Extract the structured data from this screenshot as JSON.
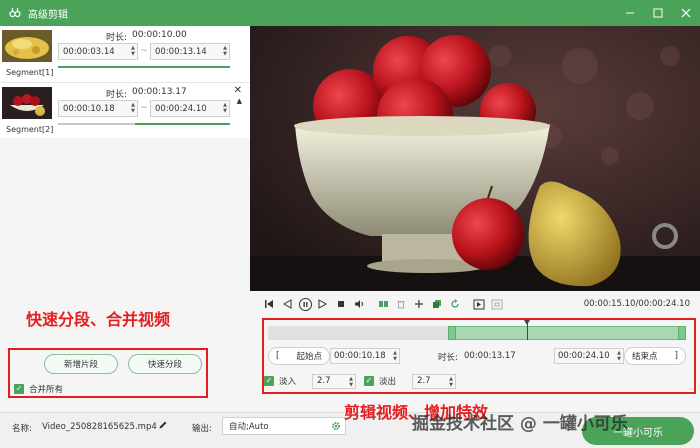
{
  "window": {
    "title": "高级剪辑"
  },
  "segments": [
    {
      "label": "Segment[1]",
      "duration_label": "时长:",
      "duration": "00:00:10.00",
      "start": "00:00:03.14",
      "end": "00:00:13.14",
      "bar_fill_start": 0.0,
      "bar_fill_end": 1.0
    },
    {
      "label": "Segment[2]",
      "duration_label": "时长:",
      "duration": "00:00:13.17",
      "start": "00:00:10.18",
      "end": "00:00:24.10",
      "bar_fill_start": 0.45,
      "bar_fill_end": 1.0
    }
  ],
  "annotations": {
    "left": "快速分段、合并视频",
    "right": "剪辑视频、增加特效",
    "watermark": "掘金技术社区 @ 一罐小可乐"
  },
  "left_actions": {
    "add_segment": "新增片段",
    "quick_split": "快速分段",
    "merge_all": "合并所有"
  },
  "player": {
    "time_readout": "00:00:15.10/00:00:24.10",
    "timeline_range_start": 0.43,
    "timeline_range_end": 1.0,
    "playhead": 0.62
  },
  "range": {
    "start_btn": "起始点",
    "start_time": "00:00:10.18",
    "duration_label": "时长:",
    "duration": "00:00:13.17",
    "end_time": "00:00:24.10",
    "end_btn": "结束点"
  },
  "fade": {
    "fade_in_label": "淡入",
    "fade_in": "2.7",
    "fade_out_label": "淡出",
    "fade_out": "2.7"
  },
  "bottom": {
    "name_label": "名称:",
    "name_value": "Video_250828165625.mp4",
    "output_label": "输出:",
    "output_value": "自动;Auto",
    "start_button": "一罐小可乐"
  },
  "colors": {
    "accent": "#4aa359",
    "annotation": "#e31e1e"
  },
  "icons": [
    "app-icon",
    "minimize-icon",
    "maximize-icon",
    "close-icon",
    "skip-start-icon",
    "step-back-icon",
    "pause-icon",
    "step-forward-icon",
    "stop-icon",
    "volume-icon",
    "split-icon",
    "delete-icon",
    "add-icon",
    "copy-icon",
    "rotate-icon",
    "mark-in-icon",
    "mark-out-icon",
    "edit-icon",
    "gear-icon"
  ]
}
